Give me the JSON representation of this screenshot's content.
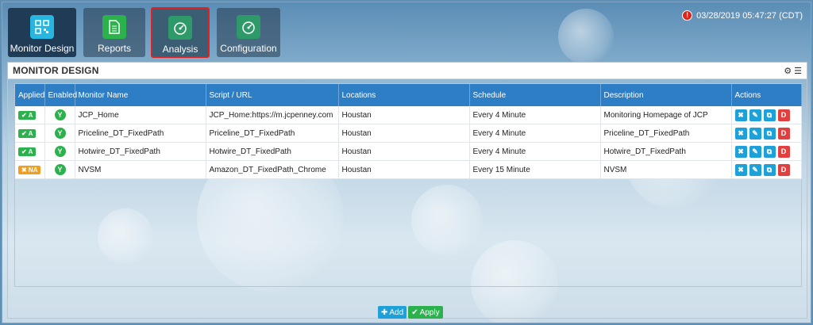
{
  "header": {
    "nav": [
      {
        "label": "Monitor Design",
        "icon": "qr-grid-icon",
        "color": "#27b6e0"
      },
      {
        "label": "Reports",
        "icon": "document-icon",
        "color": "#2bb24c"
      },
      {
        "label": "Analysis",
        "icon": "gauge-icon",
        "color": "#2e9a6a"
      },
      {
        "label": "Configuration",
        "icon": "gauge-icon",
        "color": "#2e9a6a"
      }
    ],
    "timestamp": "03/28/2019 05:47:27 (CDT)",
    "alert_icon": "alert-icon"
  },
  "panel": {
    "title": "MONITOR DESIGN",
    "tools": [
      "gear-icon",
      "list-icon"
    ]
  },
  "table": {
    "columns": [
      "Applied",
      "Enabled",
      "Monitor Name",
      "Script / URL",
      "Locations",
      "Schedule",
      "Description",
      "Actions"
    ],
    "rows": [
      {
        "applied": "✔ A",
        "applied_status": "ok",
        "enabled": "Y",
        "name": "JCP_Home",
        "script": "JCP_Home:https://m.jcpenney.com",
        "location": "Houstan",
        "schedule": "Every 4 Minute",
        "description": "Monitoring Homepage of JCP"
      },
      {
        "applied": "✔ A",
        "applied_status": "ok",
        "enabled": "Y",
        "name": "Priceline_DT_FixedPath",
        "script": "Priceline_DT_FixedPath",
        "location": "Houstan",
        "schedule": "Every 4 Minute",
        "description": "Priceline_DT_FixedPath"
      },
      {
        "applied": "✔ A",
        "applied_status": "ok",
        "enabled": "Y",
        "name": "Hotwire_DT_FixedPath",
        "script": "Hotwire_DT_FixedPath",
        "location": "Houstan",
        "schedule": "Every 4 Minute",
        "description": "Hotwire_DT_FixedPath"
      },
      {
        "applied": "✖ NA",
        "applied_status": "na",
        "enabled": "Y",
        "name": "NVSM",
        "script": "Amazon_DT_FixedPath_Chrome",
        "location": "Houstan",
        "schedule": "Every 15 Minute",
        "description": "NVSM"
      }
    ],
    "actions": [
      "✖",
      "✎",
      "⧉",
      "D"
    ]
  },
  "footer": {
    "add_label": "Add",
    "apply_label": "Apply"
  }
}
